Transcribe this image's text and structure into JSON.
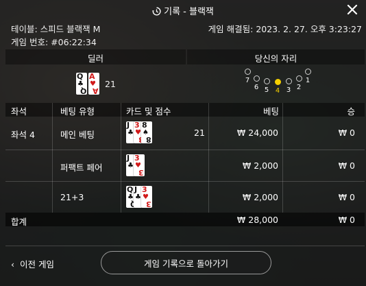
{
  "header": {
    "title": "기록 - 블랙잭",
    "top_right_fragment": "#06:22:34"
  },
  "info": {
    "table_label": "테이블: 스피드 블랙잭 M",
    "game_number_label": "게임 번호: #06:22:34",
    "settled_label": "게임 해결됨: 2023. 2. 27. 오후 3:23:27"
  },
  "dealer": {
    "heading": "딜러",
    "cards": [
      {
        "rank": "Q",
        "suit": "♣",
        "color": "black"
      },
      {
        "rank": "A",
        "suit": "♥",
        "color": "red"
      }
    ],
    "score": "21"
  },
  "seat_section": {
    "heading": "당신의 자리",
    "seats": [
      "7",
      "6",
      "5",
      "4",
      "3",
      "2",
      "1"
    ],
    "active_seat": "4"
  },
  "table": {
    "columns": {
      "seat": "좌석",
      "bet_type": "베팅 유형",
      "cards": "카드 및 점수",
      "bet": "베팅",
      "win": "승"
    },
    "rows": [
      {
        "seat": "좌석 4",
        "bet_type": "메인 베팅",
        "cards": [
          {
            "rank": "J",
            "suit": "♣",
            "color": "black"
          },
          {
            "rank": "3",
            "suit": "♥",
            "color": "red"
          },
          {
            "rank": "8",
            "suit": "♠",
            "color": "black"
          }
        ],
        "score": "21",
        "bet": "₩ 24,000",
        "win": "₩ 0"
      },
      {
        "seat": "",
        "bet_type": "퍼팩트 페어",
        "cards": [
          {
            "rank": "J",
            "suit": "♣",
            "color": "black"
          },
          {
            "rank": "3",
            "suit": "♥",
            "color": "red"
          }
        ],
        "score": "",
        "bet": "₩ 2,000",
        "win": "₩ 0"
      },
      {
        "seat": "",
        "bet_type": "21+3",
        "cards": [
          {
            "rank": "Q",
            "suit": "♣",
            "color": "black"
          },
          {
            "rank": "J",
            "suit": "♣",
            "color": "black"
          },
          {
            "rank": "3",
            "suit": "♥",
            "color": "red"
          }
        ],
        "score": "",
        "bet": "₩ 2,000",
        "win": "₩ 0"
      }
    ],
    "total": {
      "label": "합계",
      "bet": "₩ 28,000",
      "win": "₩ 0"
    }
  },
  "footer": {
    "back_label": "이전 게임",
    "return_label": "게임 기록으로 돌아가기"
  },
  "colors": {
    "active_seat": "#f5d000",
    "red_suit": "#d11a1a"
  }
}
